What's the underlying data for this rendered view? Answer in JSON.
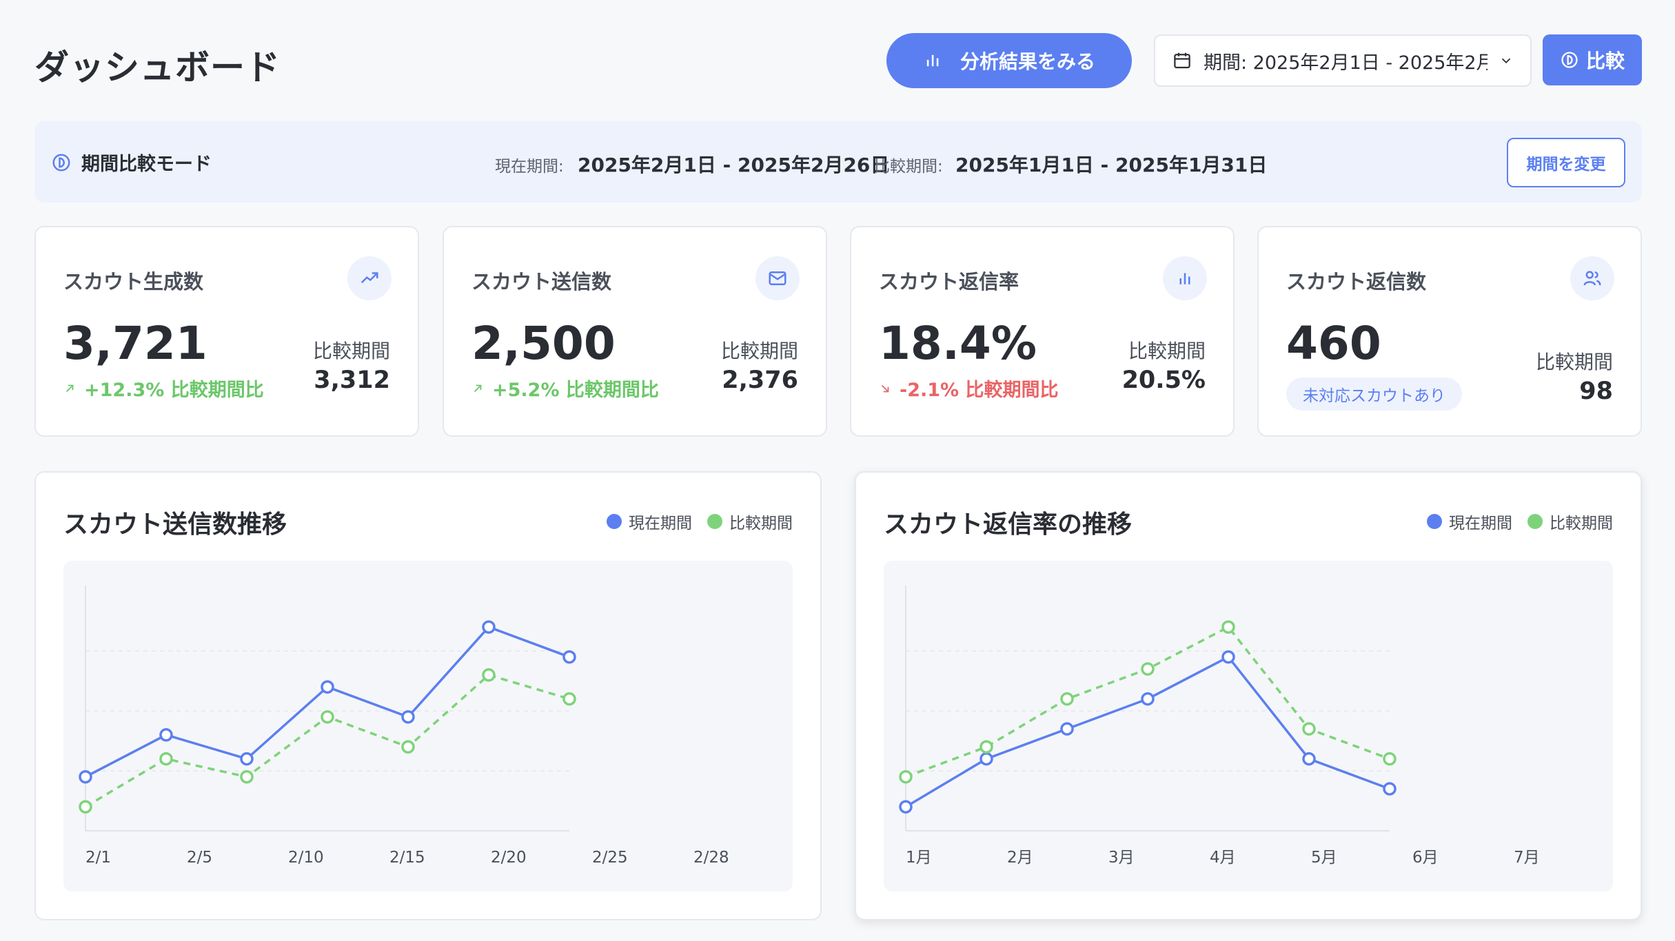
{
  "header": {
    "title": "ダッシュボード",
    "analyze_label": "分析結果をみる",
    "period_label": "期間: 2025年2月1日 - 2025年2月",
    "compare_label": "比較"
  },
  "banner": {
    "mode_label": "期間比較モード",
    "current_label": "現在期間:",
    "current_value": "2025年2月1日 - 2025年2月26日",
    "compare_label": "比較期間:",
    "compare_value": "2025年1月1日 - 2025年1月31日",
    "change_button": "期間を変更"
  },
  "kpis": [
    {
      "title": "スカウト生成数",
      "icon": "trending-up-icon",
      "value": "3,721",
      "change": "+12.3% 比較期間比",
      "direction": "up",
      "compare_label": "比較期間",
      "compare_value": "3,312"
    },
    {
      "title": "スカウト送信数",
      "icon": "mail-icon",
      "value": "2,500",
      "change": "+5.2% 比較期間比",
      "direction": "up",
      "compare_label": "比較期間",
      "compare_value": "2,376"
    },
    {
      "title": "スカウト返信率",
      "icon": "bar-chart-icon",
      "value": "18.4%",
      "change": "-2.1% 比較期間比",
      "direction": "down",
      "compare_label": "比較期間",
      "compare_value": "20.5%"
    },
    {
      "title": "スカウト返信数",
      "icon": "users-icon",
      "value": "460",
      "badge": "未対応スカウトあり",
      "compare_label": "比較期間",
      "compare_value": "98"
    }
  ],
  "colors": {
    "accent": "#5b7ff1",
    "current": "#5b7ff1",
    "compare": "#7ed37a",
    "up": "#6cc76a",
    "down": "#ea6466"
  },
  "chart_data": [
    {
      "type": "line",
      "title": "スカウト送信数推移",
      "x_ticks": [
        "2/1",
        "2/5",
        "2/10",
        "2/15",
        "2/20",
        "2/25",
        "2/28"
      ],
      "points_count": 7,
      "series": [
        {
          "name": "現在期間",
          "style": "solid",
          "values": [
            9,
            16,
            12,
            24,
            19,
            34,
            29
          ]
        },
        {
          "name": "比較期間",
          "style": "dashed",
          "values": [
            4,
            12,
            9,
            19,
            14,
            26,
            22
          ]
        }
      ],
      "ylim": [
        0,
        40
      ],
      "grid": true
    },
    {
      "type": "line",
      "title": "スカウト返信率の推移",
      "x_ticks": [
        "1月",
        "2月",
        "3月",
        "4月",
        "5月",
        "6月",
        "7月"
      ],
      "points_count": 7,
      "series": [
        {
          "name": "現在期間",
          "style": "solid",
          "values": [
            4,
            12,
            17,
            22,
            29,
            12,
            7
          ]
        },
        {
          "name": "比較期間",
          "style": "dashed",
          "values": [
            9,
            14,
            22,
            27,
            34,
            17,
            12
          ]
        }
      ],
      "ylim": [
        0,
        40
      ],
      "grid": true
    }
  ]
}
